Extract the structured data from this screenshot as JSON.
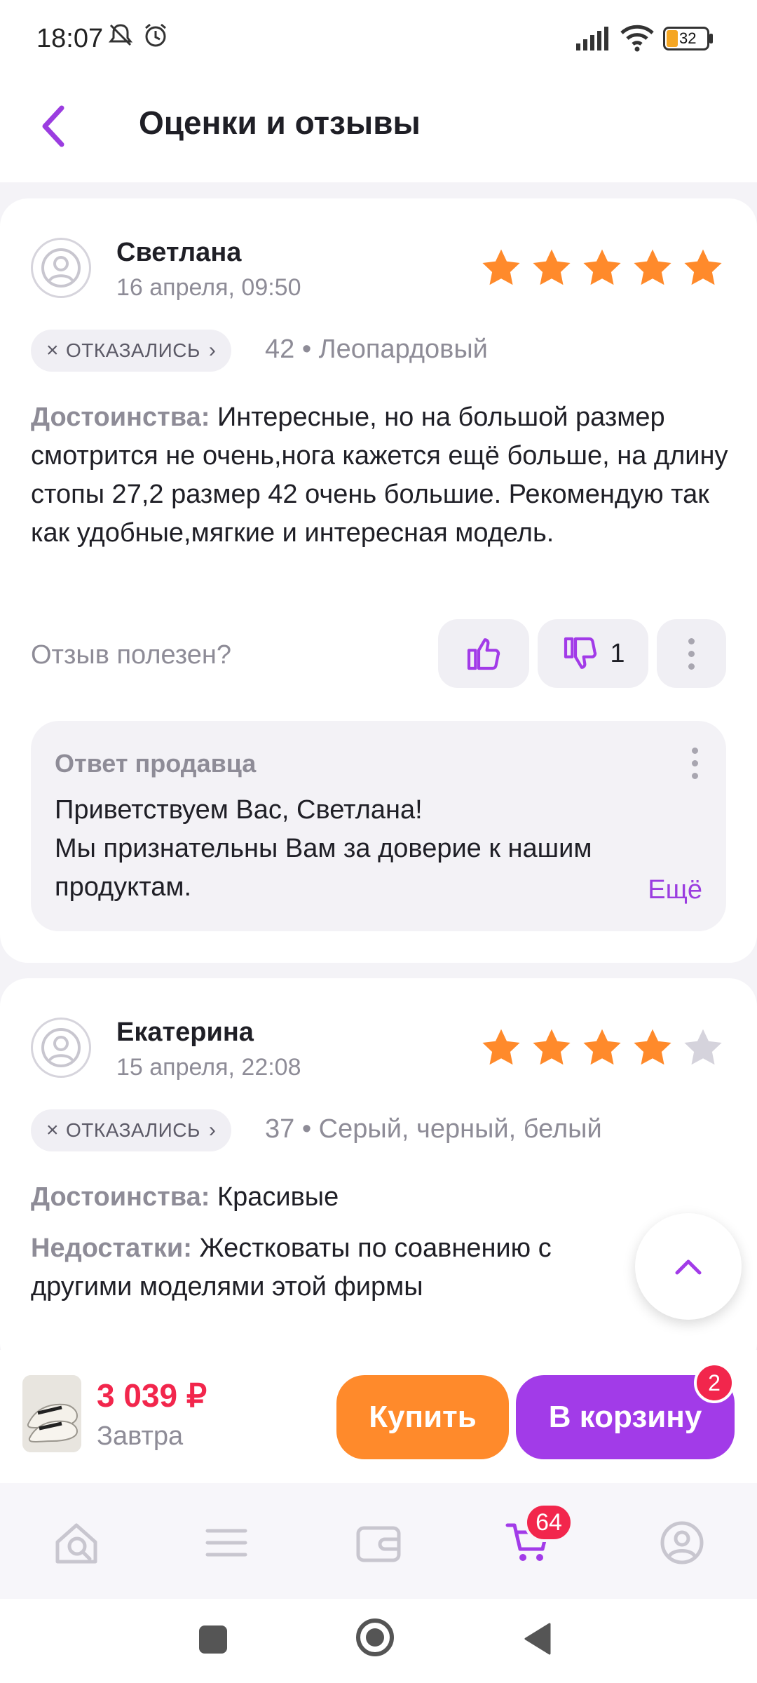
{
  "status": {
    "time": "18:07",
    "battery": "32"
  },
  "header": {
    "title": "Оценки и отзывы"
  },
  "reviews": [
    {
      "name": "Светлана",
      "date": "16 апреля, 09:50",
      "rating": 5,
      "chip": "ОТКАЗАЛИСЬ",
      "variant": "42 • Леопардовый",
      "pros_label": "Достоинства:",
      "pros": "Интересные, но на большой размер смотрится не очень,нога кажется ещё больше, на длину стопы 27,2 размер 42 очень большие. Рекомендую так как удобные,мягкие и интересная модель.",
      "useful_q": "Отзыв полезен?",
      "dislikes": "1",
      "reply": {
        "title": "Ответ продавца",
        "line1": "Приветствуем Вас, Светлана!",
        "line2": "Мы признательны Вам за доверие к нашим продуктам.",
        "more": "Ещё"
      }
    },
    {
      "name": "Екатерина",
      "date": "15 апреля, 22:08",
      "rating": 4,
      "chip": "ОТКАЗАЛИСЬ",
      "variant": "37 • Серый, черный, белый",
      "pros_label": "Достоинства:",
      "pros": "Красивые",
      "cons_label": "Недостатки:",
      "cons": "Жестковаты по соавнению с другими моделями этой фирмы"
    }
  ],
  "buybar": {
    "price": "3 039 ₽",
    "delivery": "Завтра",
    "buy_label": "Купить",
    "cart_label": "В корзину",
    "cart_count": "2"
  },
  "tabbar": {
    "cart_badge": "64"
  },
  "colors": {
    "accent": "#a23be8",
    "orange": "#ff8a2b",
    "price": "#f2264c",
    "star": "#ff8a2b",
    "star_empty": "#d5d3dc"
  },
  "icons": [
    "back-icon",
    "avatar-icon",
    "star-icon",
    "thumb-up-icon",
    "thumb-down-icon",
    "more-vert-icon",
    "chevron-up-icon",
    "search-icon",
    "menu-icon",
    "wallet-icon",
    "cart-icon",
    "profile-icon"
  ]
}
